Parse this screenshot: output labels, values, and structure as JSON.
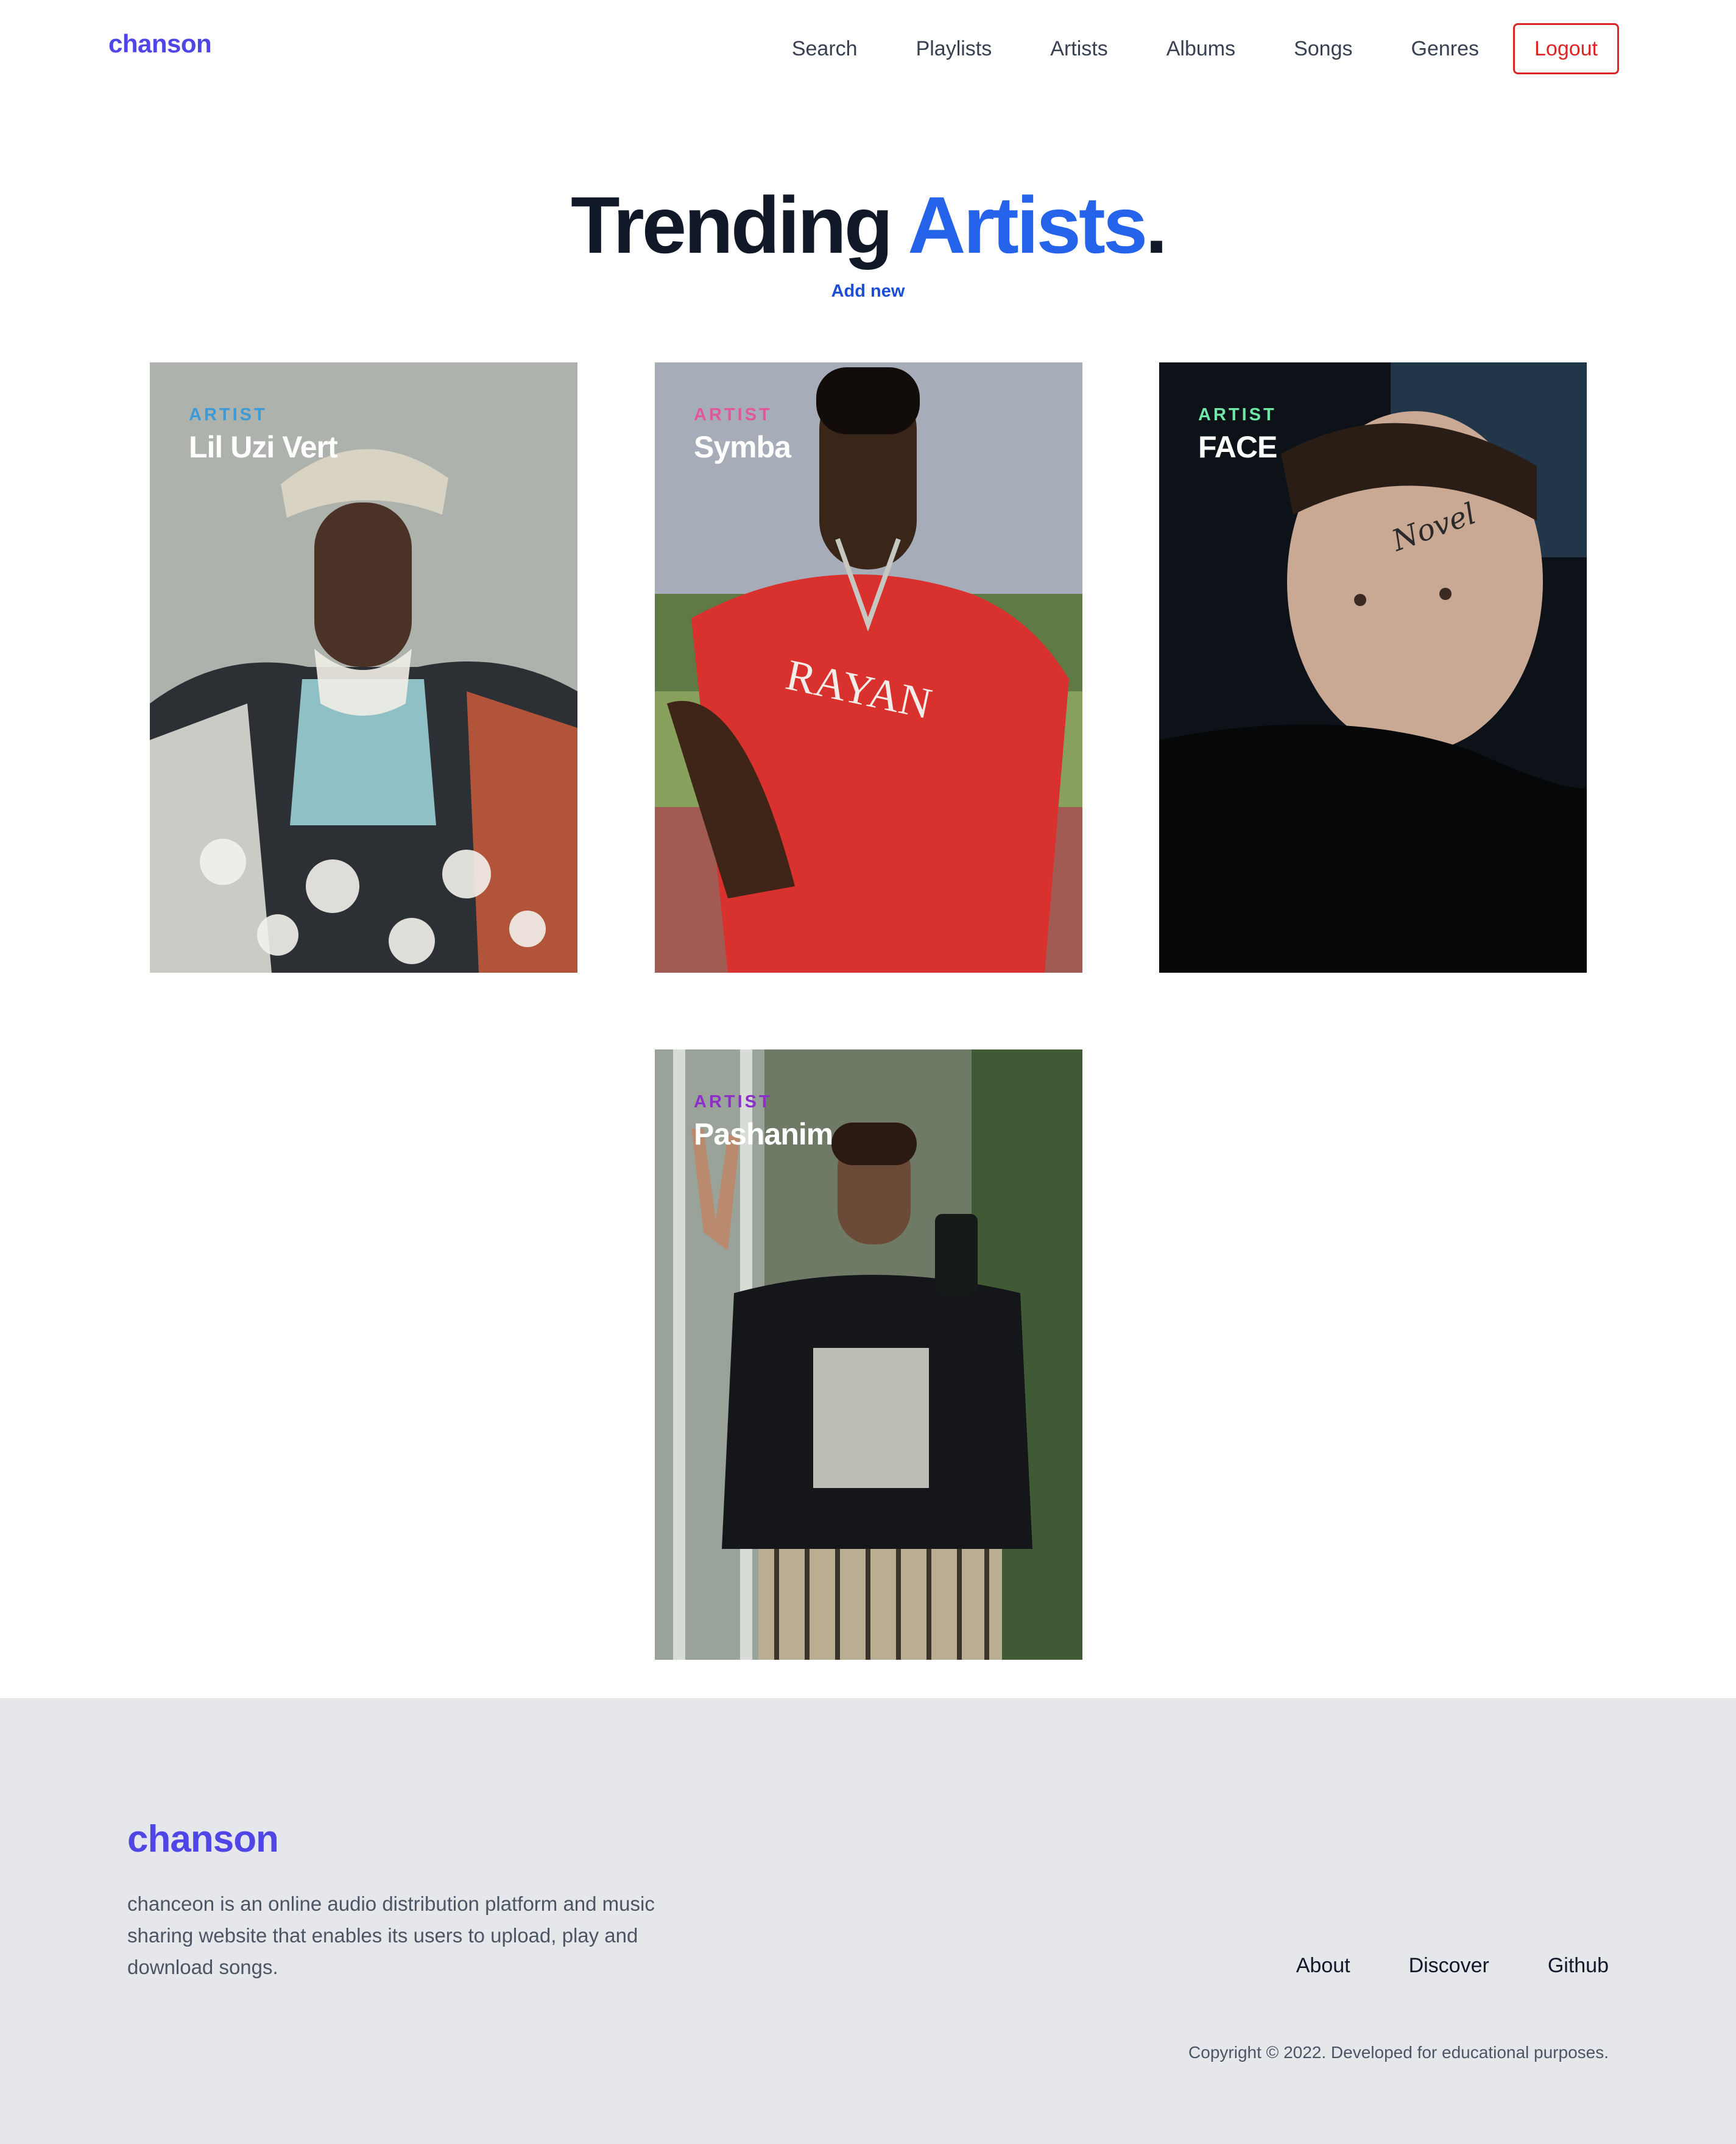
{
  "header": {
    "brand": "chanson",
    "nav": [
      "Search",
      "Playlists",
      "Artists",
      "Albums",
      "Songs",
      "Genres"
    ],
    "logout_label": "Logout"
  },
  "hero": {
    "title_main": "Trending ",
    "title_accent": "Artists",
    "title_end": ".",
    "add_new": "Add new"
  },
  "artists": [
    {
      "tag": "ARTIST",
      "name": "Lil Uzi Vert",
      "tag_color": "#3b9bd9"
    },
    {
      "tag": "ARTIST",
      "name": "Symba",
      "tag_color": "#e0579b"
    },
    {
      "tag": "ARTIST",
      "name": "FACE",
      "tag_color": "#6ee7a8"
    },
    {
      "tag": "ARTIST",
      "name": "Pashanim",
      "tag_color": "#8b2fc9"
    }
  ],
  "footer": {
    "brand": "chanson",
    "description": "chanceon is an online audio distribution platform and music sharing website that enables its users to upload, play and download songs.",
    "links": [
      "About",
      "Discover",
      "Github"
    ],
    "copyright": "Copyright © 2022. Developed for educational purposes."
  },
  "colors": {
    "brand": "#4f46e5",
    "accent": "#2563eb",
    "danger": "#dc2626",
    "footer_bg": "#e5e7eb"
  }
}
